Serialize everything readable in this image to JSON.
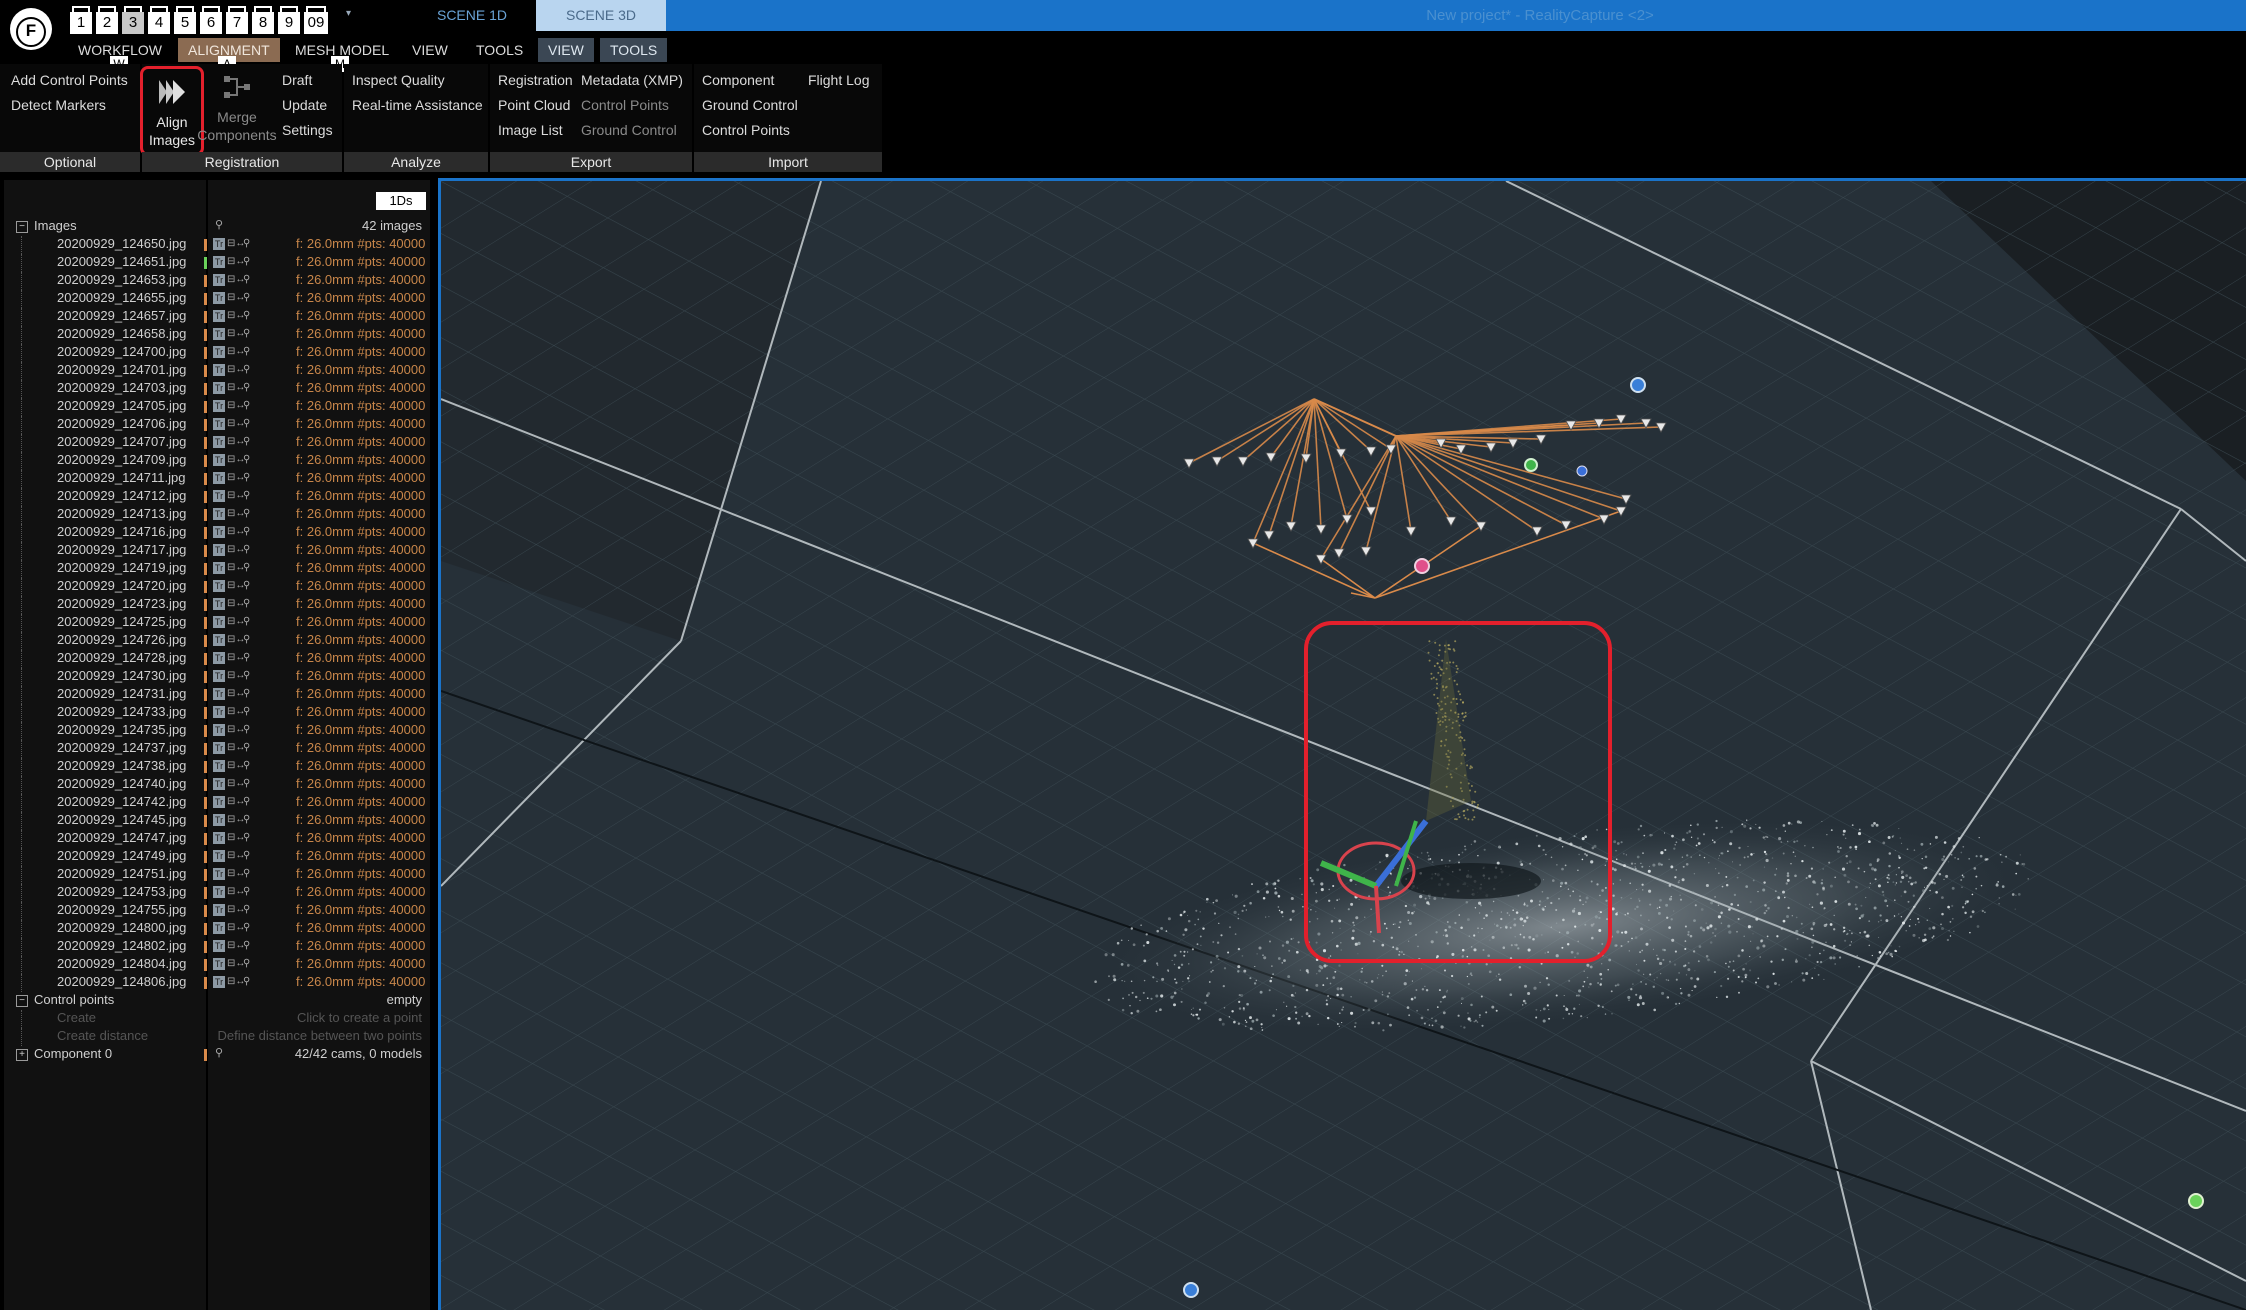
{
  "titlebar": {
    "logo_letter": "F",
    "layout_slots": [
      "1",
      "2",
      "3",
      "4",
      "5",
      "6",
      "7",
      "8",
      "9",
      "09"
    ],
    "scene_tabs": [
      "SCENE 1D",
      "SCENE 3D"
    ],
    "window_title": "New project* - RealityCapture <2>"
  },
  "menus": {
    "workflow": "WORKFLOW",
    "alignment": "ALIGNMENT",
    "mesh_model": "MESH MODEL",
    "view": "VIEW",
    "tools": "TOOLS",
    "view2": "VIEW",
    "tools2": "TOOLS",
    "shortcut_w": "W",
    "shortcut_a": "A",
    "shortcut_m": "M"
  },
  "ribbon": {
    "optional": {
      "label": "Optional",
      "items": [
        "Add Control Points",
        "Detect Markers"
      ]
    },
    "registration": {
      "label": "Registration",
      "align": [
        "Align",
        "Images"
      ],
      "merge": [
        "Merge",
        "Components"
      ],
      "items": [
        "Draft",
        "Update",
        "Settings"
      ]
    },
    "analyze": {
      "label": "Analyze",
      "items": [
        "Inspect Quality",
        "Real-time Assistance"
      ]
    },
    "export": {
      "label": "Export",
      "items": [
        "Registration",
        "Point Cloud",
        "Image List"
      ],
      "items2": [
        "Metadata (XMP)",
        "Control Points",
        "Ground Control"
      ]
    },
    "import": {
      "label": "Import",
      "items": [
        "Component",
        "Ground Control",
        "Control Points"
      ],
      "items2": [
        "Flight Log"
      ]
    }
  },
  "panel": {
    "view_button": "1Ds",
    "images_label": "Images",
    "images_count": "42 images",
    "image_meta": "f: 26.0mm #pts: 40000",
    "images": [
      "20200929_124650.jpg",
      "20200929_124651.jpg",
      "20200929_124653.jpg",
      "20200929_124655.jpg",
      "20200929_124657.jpg",
      "20200929_124658.jpg",
      "20200929_124700.jpg",
      "20200929_124701.jpg",
      "20200929_124703.jpg",
      "20200929_124705.jpg",
      "20200929_124706.jpg",
      "20200929_124707.jpg",
      "20200929_124709.jpg",
      "20200929_124711.jpg",
      "20200929_124712.jpg",
      "20200929_124713.jpg",
      "20200929_124716.jpg",
      "20200929_124717.jpg",
      "20200929_124719.jpg",
      "20200929_124720.jpg",
      "20200929_124723.jpg",
      "20200929_124725.jpg",
      "20200929_124726.jpg",
      "20200929_124728.jpg",
      "20200929_124730.jpg",
      "20200929_124731.jpg",
      "20200929_124733.jpg",
      "20200929_124735.jpg",
      "20200929_124737.jpg",
      "20200929_124738.jpg",
      "20200929_124740.jpg",
      "20200929_124742.jpg",
      "20200929_124745.jpg",
      "20200929_124747.jpg",
      "20200929_124749.jpg",
      "20200929_124751.jpg",
      "20200929_124753.jpg",
      "20200929_124755.jpg",
      "20200929_124800.jpg",
      "20200929_124802.jpg",
      "20200929_124804.jpg",
      "20200929_124806.jpg"
    ],
    "control_points_label": "Control points",
    "control_points_value": "empty",
    "create_label": "Create",
    "create_hint": "Click to create a point",
    "create_distance_label": "Create distance",
    "create_distance_hint": "Define distance between two points",
    "component_label": "Component 0",
    "component_value": "42/42 cams, 0 models"
  },
  "colors": {
    "accent_blue": "#1a73c9",
    "highlight_red": "#e3202c",
    "camera_orange": "#d98a4a",
    "meta_orange": "#c8864a"
  }
}
